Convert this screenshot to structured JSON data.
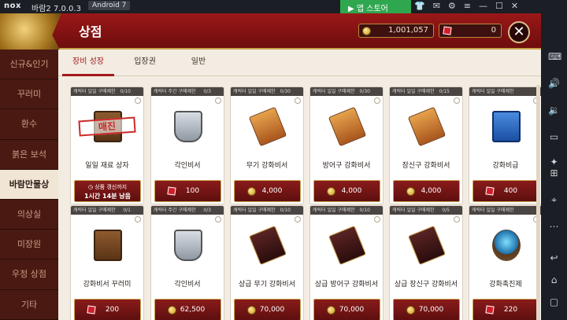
{
  "emulator": {
    "logo": "nox",
    "title": "바람2 7.0.0.3",
    "android_badge": "Android 7",
    "store_label": "앱 스토어",
    "icons": [
      "shirt-icon",
      "mail-icon",
      "gear-icon",
      "menu-icon",
      "minimize-icon",
      "maximize-icon",
      "close-icon"
    ],
    "side_icons": [
      "keyboard-icon",
      "volume-up-icon",
      "volume-down-icon",
      "screen-icon",
      "shake-icon",
      "add-apk-icon",
      "location-icon",
      "more-icon",
      "back-icon",
      "home-icon",
      "recent-apps-icon"
    ]
  },
  "header": {
    "title": "상점",
    "gold": "1,001,057",
    "ruby": "0",
    "close": "✕"
  },
  "left_menu": [
    {
      "label": "신규&인기"
    },
    {
      "label": "꾸러미"
    },
    {
      "label": "환수"
    },
    {
      "label": "붉은 보석"
    },
    {
      "label": "바람만물상"
    },
    {
      "label": "의상실"
    },
    {
      "label": "미장원"
    },
    {
      "label": "우정 상점"
    },
    {
      "label": "기타"
    }
  ],
  "tabs": [
    {
      "label": "장비 성장"
    },
    {
      "label": "입장권"
    },
    {
      "label": "일반"
    }
  ],
  "items_row1": [
    {
      "limit": "캐릭터 일일 구매제한",
      "count": "0/10",
      "name": "일일 재료 상자",
      "sold_out": "매진",
      "refresh1": "상품 갱신까지",
      "refresh2": "1시간 14분 남음",
      "art": "box",
      "currency": "clock"
    },
    {
      "limit": "캐릭터 주간 구매제한",
      "count": "0/3",
      "name": "각인비서",
      "price": "100",
      "art": "shield",
      "currency": "ruby"
    },
    {
      "limit": "캐릭터 일일 구매제한",
      "count": "0/30",
      "name": "무기 강화비서",
      "price": "4,000",
      "art": "scroll",
      "currency": "gold"
    },
    {
      "limit": "캐릭터 일일 구매제한",
      "count": "0/30",
      "name": "방어구 강화비서",
      "price": "4,000",
      "art": "scroll",
      "currency": "gold"
    },
    {
      "limit": "캐릭터 일일 구매제한",
      "count": "0/15",
      "name": "장신구 강화비서",
      "price": "4,000",
      "art": "scroll",
      "currency": "gold"
    },
    {
      "limit": "캐릭터 일일 구매제한",
      "count": "",
      "name": "강화비급",
      "price": "400",
      "art": "book",
      "currency": "ruby"
    }
  ],
  "items_row2": [
    {
      "limit": "캐릭터 일일 구매제한",
      "count": "0/1",
      "name": "강화비서 꾸러미",
      "price": "200",
      "art": "box",
      "currency": "ruby"
    },
    {
      "limit": "캐릭터 주간 구매제한",
      "count": "0/3",
      "name": "각인비서",
      "price": "62,500",
      "art": "shield",
      "currency": "gold"
    },
    {
      "limit": "캐릭터 일일 구매제한",
      "count": "0/10",
      "name": "상급 무기 강화비서",
      "price": "70,000",
      "art": "scroll2",
      "currency": "gold"
    },
    {
      "limit": "캐릭터 일일 구매제한",
      "count": "0/10",
      "name": "상급 방어구 강화비서",
      "price": "70,000",
      "art": "scroll2",
      "currency": "gold"
    },
    {
      "limit": "캐릭터 일일 구매제한",
      "count": "0/5",
      "name": "상급 장신구 강화비서",
      "price": "70,000",
      "art": "scroll2",
      "currency": "gold"
    },
    {
      "limit": "캐릭터 일일 구매제한",
      "count": "",
      "name": "강화촉진제",
      "price": "220",
      "art": "orb",
      "currency": "ruby"
    }
  ]
}
